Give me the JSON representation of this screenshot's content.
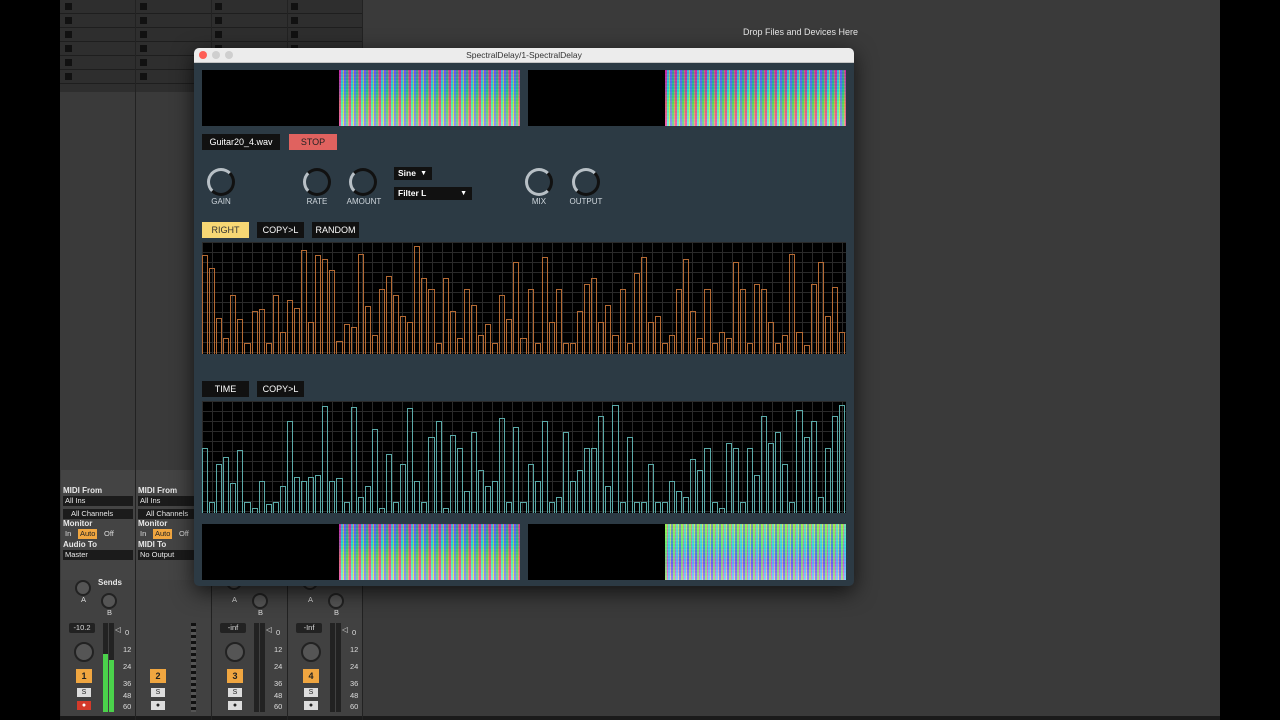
{
  "session": {
    "drop_text": "Drop Files and Devices Here"
  },
  "io": {
    "midi_from_label": "MIDI From",
    "all_ins": "All Ins",
    "all_channels": "All Channels",
    "monitor_label": "Monitor",
    "monitor_in": "In",
    "monitor_auto": "Auto",
    "monitor_off": "Off",
    "audio_to_label": "Audio To",
    "audio_to_value": "Master",
    "midi_to_label": "MIDI To",
    "midi_to_value": "No Output"
  },
  "mixer": {
    "sends_label": "Sends",
    "send_a": "A",
    "send_b": "B",
    "tracks": [
      {
        "number": "1",
        "volume": "-10.2",
        "solo": "S"
      },
      {
        "number": "2",
        "volume": "",
        "solo": "S"
      },
      {
        "number": "3",
        "volume": "-inf",
        "solo": "S"
      },
      {
        "number": "4",
        "volume": "-Inf",
        "solo": "S"
      }
    ],
    "scale": [
      "0",
      "12",
      "24",
      "36",
      "48",
      "60"
    ]
  },
  "plugin": {
    "title": "SpectralDelay/1-SpectralDelay",
    "file_name": "Guitar20_4.wav",
    "stop_label": "STOP",
    "knobs": {
      "gain": "GAIN",
      "rate": "RATE",
      "amount": "AMOUNT",
      "mix": "MIX",
      "output": "OUTPUT"
    },
    "waveform_select": "Sine",
    "filter_select": "Filter L",
    "buttons": {
      "right": "RIGHT",
      "copy_l_1": "COPY>L",
      "random": "RANDOM",
      "time": "TIME",
      "copy_l_2": "COPY>L"
    },
    "colors": {
      "right_active": "#f7d774",
      "stop": "#e0625f",
      "filter_bars": "#b56a33",
      "time_bars": "#5aaaa8"
    },
    "filter_bars": [
      0.92,
      0.8,
      0.33,
      0.15,
      0.55,
      0.32,
      0.1,
      0.4,
      0.42,
      0.1,
      0.55,
      0.2,
      0.5,
      0.43,
      0.96,
      0.3,
      0.92,
      0.88,
      0.78,
      0.12,
      0.28,
      0.25,
      0.93,
      0.44,
      0.18,
      0.6,
      0.72,
      0.55,
      0.35,
      0.3,
      1.0,
      0.7,
      0.6,
      0.1,
      0.7,
      0.4,
      0.15,
      0.6,
      0.45,
      0.18,
      0.28,
      0.1,
      0.55,
      0.32,
      0.85,
      0.15,
      0.6,
      0.1,
      0.9,
      0.3,
      0.6,
      0.1,
      0.1,
      0.4,
      0.65,
      0.7,
      0.3,
      0.45,
      0.18,
      0.6,
      0.1,
      0.75,
      0.9,
      0.3,
      0.35,
      0.1,
      0.18,
      0.6,
      0.88,
      0.4,
      0.15,
      0.6,
      0.1,
      0.2,
      0.15,
      0.85,
      0.6,
      0.1,
      0.65,
      0.6,
      0.3,
      0.1,
      0.18,
      0.93,
      0.2,
      0.08,
      0.65,
      0.85,
      0.35,
      0.62,
      0.2
    ],
    "time_bars": [
      0.6,
      0.1,
      0.45,
      0.52,
      0.28,
      0.58,
      0.1,
      0.05,
      0.3,
      0.08,
      0.1,
      0.25,
      0.85,
      0.33,
      0.3,
      0.33,
      0.35,
      0.99,
      0.3,
      0.32,
      0.1,
      0.98,
      0.15,
      0.25,
      0.78,
      0.05,
      0.55,
      0.1,
      0.45,
      0.97,
      0.3,
      0.1,
      0.7,
      0.85,
      0.05,
      0.72,
      0.6,
      0.2,
      0.75,
      0.4,
      0.25,
      0.3,
      0.88,
      0.1,
      0.8,
      0.1,
      0.45,
      0.3,
      0.85,
      0.1,
      0.15,
      0.75,
      0.3,
      0.4,
      0.6,
      0.6,
      0.9,
      0.25,
      1.0,
      0.1,
      0.7,
      0.1,
      0.1,
      0.45,
      0.1,
      0.1,
      0.3,
      0.2,
      0.15,
      0.5,
      0.4,
      0.6,
      0.1,
      0.05,
      0.65,
      0.6,
      0.1,
      0.6,
      0.35,
      0.9,
      0.65,
      0.75,
      0.45,
      0.1,
      0.95,
      0.7,
      0.85,
      0.15,
      0.6,
      0.9,
      1.0
    ]
  }
}
